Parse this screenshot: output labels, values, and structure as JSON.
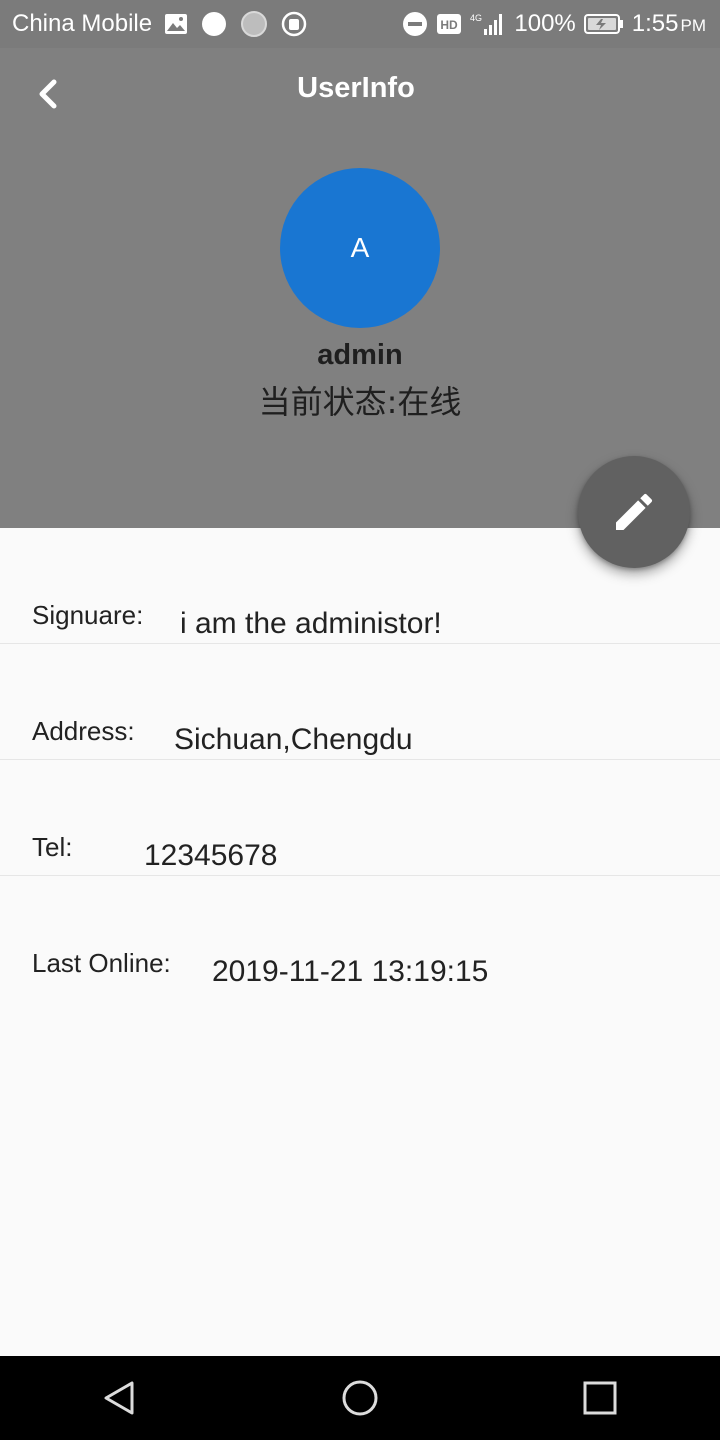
{
  "status_bar": {
    "carrier": "China Mobile",
    "hd_label": "HD",
    "network_label": "4G",
    "battery_percent": "100%",
    "time": "1:55",
    "ampm": "PM"
  },
  "header": {
    "title": "UserInfo",
    "avatar_letter": "A",
    "username": "admin",
    "status_text": "当前状态:在线",
    "background_color": "#808080",
    "avatar_color": "#1976d2"
  },
  "fab": {
    "icon": "pencil-icon",
    "color": "#616161"
  },
  "info": {
    "signature_label": "Signuare:",
    "signature_value": "i am the administor!",
    "address_label": "Address:",
    "address_value": "Sichuan,Chengdu",
    "tel_label": "Tel:",
    "tel_value": "12345678",
    "last_online_label": "Last Online:",
    "last_online_value": "2019-11-21 13:19:15"
  },
  "nav": {
    "back_icon": "triangle-back-icon",
    "home_icon": "circle-home-icon",
    "recents_icon": "square-recents-icon"
  }
}
